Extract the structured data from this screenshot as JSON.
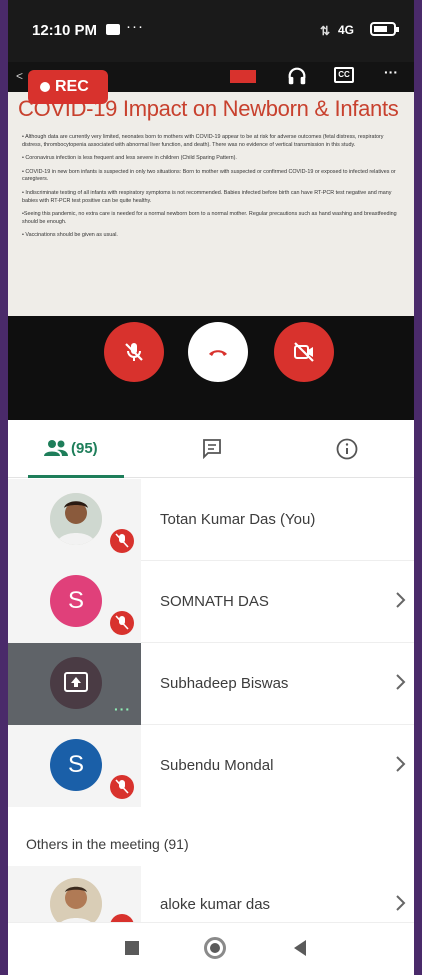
{
  "status_bar": {
    "time": "12:10 PM",
    "notification_dots": "···",
    "network": "4G",
    "battery_level": 0.7
  },
  "meeting": {
    "rec_label": "REC",
    "slide": {
      "title": "COVID-19 Impact on Newborn & Infants",
      "bullets": [
        "• Although data are currently very limited, neonates born to mothers with COVID-19 appear to be at risk for adverse outcomes (fetal distress, respiratory distress, thrombocytopenia associated with abnormal liver function, and death). There was no evidence of vertical transmission in this study.",
        "• Coronavirus infection is less frequent and less severe in children (Child Sparing Pattern).",
        "• COVID-19 in new born infants is suspected in only two situations: Born to mother with suspected or confirmed COVID-19 or exposed to infected relatives or caregivers.",
        "• Indiscriminate testing of all infants with respiratory symptoms is not recommended. Babies infected before birth can have RT-PCR test negative and many babies with RT-PCR test positive can be quite healthy.",
        "•Seeing this pandemic, no extra care is needed for a normal newborn born to a normal mother. Regular precautions such as hand washing and breastfeeding should be enough.",
        "• Vaccinations should be given as usual."
      ]
    }
  },
  "tabs": {
    "people_count": "(95)"
  },
  "participants": [
    {
      "name": "Totan Kumar Das (You)"
    },
    {
      "name": "SOMNATH DAS",
      "initial": "S",
      "avatar_color": "#e0407a"
    },
    {
      "name": "Subhadeep Biswas"
    },
    {
      "name": "Subendu Mondal",
      "initial": "S",
      "avatar_color": "#1a5fa8"
    }
  ],
  "others_header": "Others in the meeting (91)",
  "others": [
    {
      "name": "aloke kumar das"
    }
  ],
  "colors": {
    "accent_green": "#1e7e5a",
    "red": "#d8322d"
  }
}
